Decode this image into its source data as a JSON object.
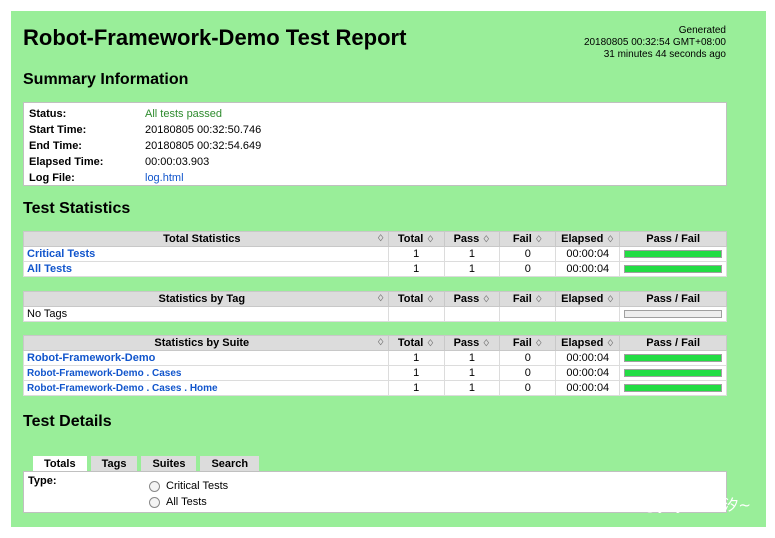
{
  "title": "Robot-Framework-Demo Test Report",
  "generated": {
    "label": "Generated",
    "timestamp": "20180805 00:32:54 GMT+08:00",
    "ago": "31 minutes 44 seconds ago"
  },
  "summary": {
    "heading": "Summary Information",
    "rows": [
      {
        "key": "Status:",
        "value": "All tests passed"
      },
      {
        "key": "Start Time:",
        "value": "20180805 00:32:50.746"
      },
      {
        "key": "End Time:",
        "value": "20180805 00:32:54.649"
      },
      {
        "key": "Elapsed Time:",
        "value": "00:00:03.903"
      },
      {
        "key": "Log File:",
        "value": "log.html"
      }
    ]
  },
  "statistics": {
    "heading": "Test Statistics",
    "columns": {
      "total": "Total",
      "pass": "Pass",
      "fail": "Fail",
      "elapsed": "Elapsed",
      "pass_fail": "Pass / Fail"
    },
    "sort_glyph": "♢",
    "total_stats": {
      "header": "Total Statistics",
      "rows": [
        {
          "name": "Critical Tests",
          "total": "1",
          "pass": "1",
          "fail": "0",
          "elapsed": "00:00:04",
          "pass_ratio": 1.0
        },
        {
          "name": "All Tests",
          "total": "1",
          "pass": "1",
          "fail": "0",
          "elapsed": "00:00:04",
          "pass_ratio": 1.0
        }
      ]
    },
    "tag_stats": {
      "header": "Statistics by Tag",
      "rows": [
        {
          "name": "No Tags",
          "total": "",
          "pass": "",
          "fail": "",
          "elapsed": "",
          "pass_ratio": 0
        }
      ]
    },
    "suite_stats": {
      "header": "Statistics by Suite",
      "rows": [
        {
          "name": "Robot-Framework-Demo",
          "total": "1",
          "pass": "1",
          "fail": "0",
          "elapsed": "00:00:04",
          "pass_ratio": 1.0
        },
        {
          "name": "Robot-Framework-Demo . Cases",
          "total": "1",
          "pass": "1",
          "fail": "0",
          "elapsed": "00:00:04",
          "pass_ratio": 1.0
        },
        {
          "name": "Robot-Framework-Demo . Cases . Home",
          "total": "1",
          "pass": "1",
          "fail": "0",
          "elapsed": "00:00:04",
          "pass_ratio": 1.0
        }
      ]
    }
  },
  "details": {
    "heading": "Test Details",
    "tabs": [
      "Totals",
      "Tags",
      "Suites",
      "Search"
    ],
    "active_tab": "Totals",
    "type_label": "Type:",
    "options": [
      "Critical Tests",
      "All Tests"
    ]
  },
  "watermark": "CSDN @yoyo小小汐~",
  "colors": {
    "background": "#99ee99",
    "pass_bar": "#22dd44",
    "link": "#1155cc",
    "status_pass": "#2e8b2e"
  }
}
